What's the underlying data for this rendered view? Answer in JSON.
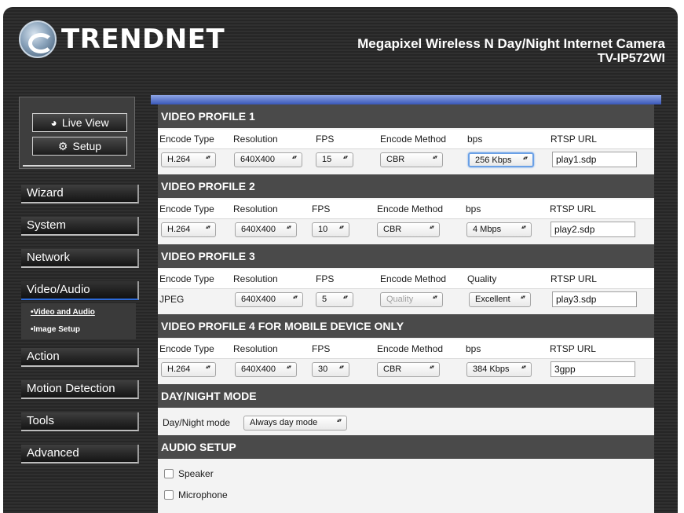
{
  "header": {
    "brand": "TRENDNET",
    "product_title": "Megapixel Wireless N Day/Night Internet Camera",
    "model": "TV-IP572WI"
  },
  "view_buttons": {
    "live_view": "Live View",
    "setup": "Setup"
  },
  "nav": {
    "items": [
      "Wizard",
      "System",
      "Network",
      "Video/Audio",
      "Action",
      "Motion Detection",
      "Tools",
      "Advanced"
    ],
    "active": "Video/Audio",
    "sub_items": [
      "Video and Audio",
      "Image Setup"
    ]
  },
  "profiles": [
    {
      "title": "VIDEO PROFILE 1",
      "labels": [
        "Encode Type",
        "Resolution",
        "FPS",
        "Encode Method",
        "bps",
        "RTSP URL"
      ],
      "encode_type": "H.264",
      "resolution": "640X400",
      "fps": "15",
      "encode_method": "CBR",
      "rate": "256 Kbps",
      "rtsp_url": "play1.sdp"
    },
    {
      "title": "VIDEO PROFILE 2",
      "labels": [
        "Encode Type",
        "Resolution",
        "FPS",
        "Encode Method",
        "bps",
        "RTSP URL"
      ],
      "encode_type": "H.264",
      "resolution": "640X400",
      "fps": "10",
      "encode_method": "CBR",
      "rate": "4 Mbps",
      "rtsp_url": "play2.sdp"
    },
    {
      "title": "VIDEO PROFILE 3",
      "labels": [
        "Encode Type",
        "Resolution",
        "FPS",
        "Encode Method",
        "Quality",
        "RTSP URL"
      ],
      "encode_type": "JPEG",
      "resolution": "640X400",
      "fps": "5",
      "encode_method": "Quality",
      "rate": "Excellent",
      "rtsp_url": "play3.sdp"
    },
    {
      "title": "VIDEO PROFILE 4 FOR MOBILE DEVICE ONLY",
      "labels": [
        "Encode Type",
        "Resolution",
        "FPS",
        "Encode Method",
        "bps",
        "RTSP URL"
      ],
      "encode_type": "H.264",
      "resolution": "640X400",
      "fps": "30",
      "encode_method": "CBR",
      "rate": "384 Kbps",
      "rtsp_url": "3gpp"
    }
  ],
  "day_night": {
    "title": "DAY/NIGHT MODE",
    "label": "Day/Night mode",
    "value": "Always day mode"
  },
  "audio": {
    "title": "AUDIO SETUP",
    "speaker": "Speaker",
    "microphone": "Microphone"
  }
}
